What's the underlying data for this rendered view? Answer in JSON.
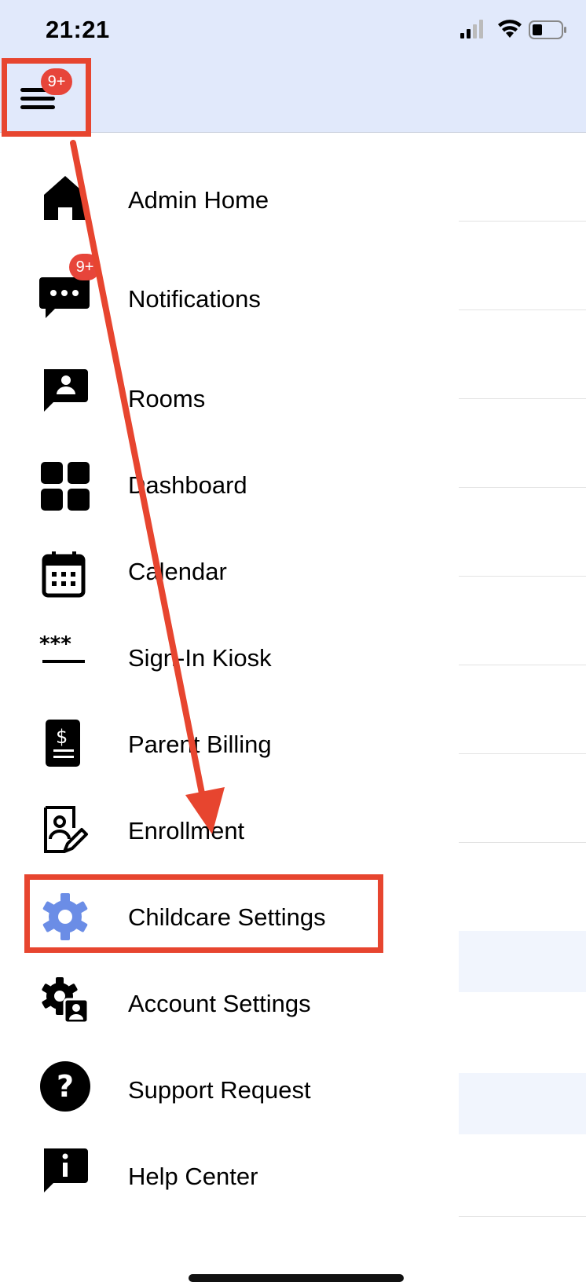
{
  "status_bar": {
    "time": "21:21"
  },
  "header": {
    "menu_badge": "9+"
  },
  "menu": [
    {
      "id": "admin-home",
      "label": "Admin Home",
      "icon": "home-icon"
    },
    {
      "id": "notifications",
      "label": "Notifications",
      "icon": "chat-bubble-icon",
      "badge": "9+"
    },
    {
      "id": "rooms",
      "label": "Rooms",
      "icon": "contact-card-icon"
    },
    {
      "id": "dashboard",
      "label": "Dashboard",
      "icon": "grid-icon"
    },
    {
      "id": "calendar",
      "label": "Calendar",
      "icon": "calendar-icon"
    },
    {
      "id": "sign-in-kiosk",
      "label": "Sign-In Kiosk",
      "icon": "password-icon"
    },
    {
      "id": "parent-billing",
      "label": "Parent Billing",
      "icon": "invoice-icon"
    },
    {
      "id": "enrollment",
      "label": "Enrollment",
      "icon": "edit-profile-icon"
    },
    {
      "id": "childcare-settings",
      "label": "Childcare Settings",
      "icon": "gear-icon",
      "active": true
    },
    {
      "id": "account-settings",
      "label": "Account Settings",
      "icon": "user-gear-icon"
    },
    {
      "id": "support-request",
      "label": "Support Request",
      "icon": "question-icon"
    },
    {
      "id": "help-center",
      "label": "Help Center",
      "icon": "info-bubble-icon"
    }
  ],
  "colors": {
    "header_bg": "#e1e9fb",
    "badge": "#e7453a",
    "annotation": "#e7452f",
    "active_icon": "#6b8de6"
  }
}
